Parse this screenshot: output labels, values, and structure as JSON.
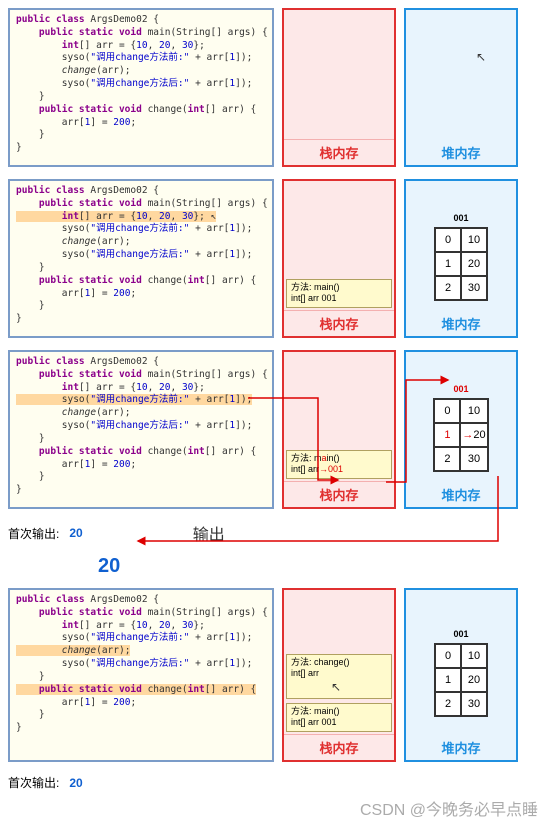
{
  "labels": {
    "stack": "栈内存",
    "heap": "堆内存",
    "output_prefix": "首次输出:",
    "output_value": "20",
    "big_output": "20",
    "out_word": "输出",
    "addr": "001",
    "watermark": "CSDN @今晚务必早点睡"
  },
  "code": {
    "l1": "public class ArgsDemo02 {",
    "l2": "    public static void main(String[] args) {",
    "l3": "        int[] arr = {10, 20, 30};",
    "l4_pre": "        syso(\"调用change方法前:\" + arr[1]);",
    "l5": "        change(arr);",
    "l6_post": "        syso(\"调用change方法后:\" + arr[1]);",
    "l7": "    }",
    "l8": "    public static void change(int[] arr) {",
    "l9": "        arr[1] = 200;",
    "l10": "    }",
    "l11": "}"
  },
  "frames": {
    "main_method": "方法: main()",
    "main_arr": "int[] arr    001",
    "change_method": "方法: change()",
    "change_arr": "int[] arr"
  },
  "array": {
    "idx0": "0",
    "val0": "10",
    "idx1": "1",
    "val1": "20",
    "idx2": "2",
    "val2": "30"
  }
}
